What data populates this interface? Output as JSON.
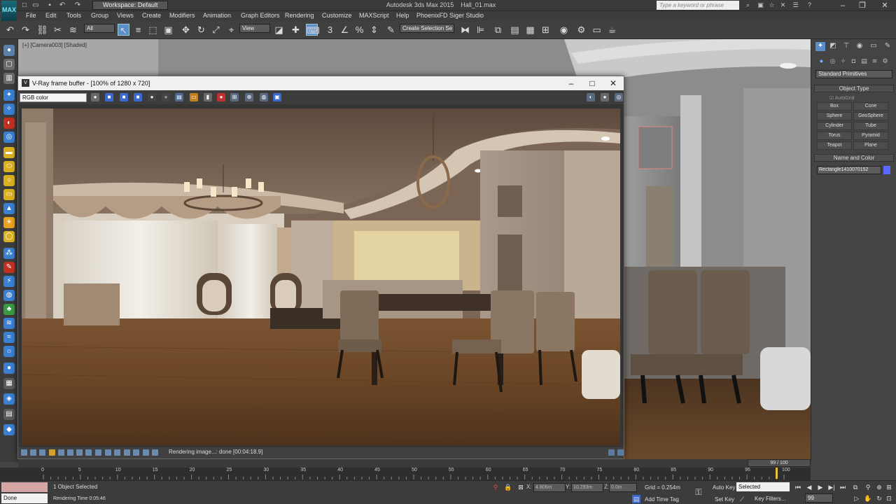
{
  "app": {
    "title": "Autodesk 3ds Max 2015",
    "file": "Hall_01.max",
    "logo": "MAX",
    "workspace": "Workspace: Default",
    "search_placeholder": "Type a keyword or phrase"
  },
  "menu": [
    "File",
    "Edit",
    "Tools",
    "Group",
    "Views",
    "Create",
    "Modifiers",
    "Animation",
    "Graph Editors",
    "Rendering",
    "Customize",
    "MAXScript",
    "Help",
    "PhoenixFD",
    "Siger Studio"
  ],
  "toolbar": {
    "filter": "All",
    "ref_coord": "View",
    "named_selection": "Create Selection Se"
  },
  "viewport": {
    "label": "[+] [Camera003] [Shaded]"
  },
  "vfb": {
    "title": "V-Ray frame buffer - [100% of 1280 x 720]",
    "channel": "RGB color",
    "status": "Rendering image...: done [00:04:18.9]"
  },
  "command_panel": {
    "category": "Standard Primitives",
    "object_type_title": "Object Type",
    "autogrid": "AutoGrid",
    "primitives": [
      "Box",
      "Cone",
      "Sphere",
      "GeoSphere",
      "Cylinder",
      "Tube",
      "Torus",
      "Pyramid",
      "Teapot",
      "Plane"
    ],
    "name_color_title": "Name and Color",
    "object_name": "Rectangle1410070152",
    "object_color": "#5a6aff"
  },
  "timeline": {
    "frame_indicator": "99 / 100",
    "ticks": [
      "0",
      "5",
      "10",
      "15",
      "20",
      "25",
      "30",
      "35",
      "40",
      "45",
      "50",
      "55",
      "60",
      "65",
      "70",
      "75",
      "80",
      "85",
      "90",
      "95",
      "100"
    ],
    "current_fraction": 0.99
  },
  "status": {
    "maxscript_output": "Done",
    "selection": "1 Object Selected",
    "render_time": "Rendering Time 0:05:46",
    "x_label": "X:",
    "x": "4.806m",
    "y_label": "Y:",
    "y": "10.293m",
    "z_label": "Z:",
    "z": "0.0m",
    "grid": "Grid = 0.254m",
    "add_time_tag": "Add Time Tag",
    "auto_key": "Auto Key",
    "set_key": "Set Key",
    "key_mode": "Selected",
    "key_filters": "Key Filters...",
    "frame": "99"
  }
}
